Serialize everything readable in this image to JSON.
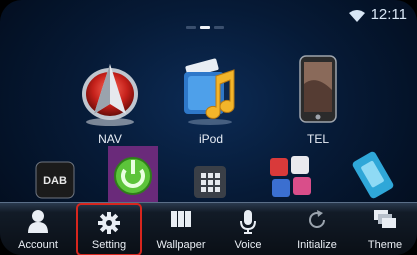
{
  "status": {
    "time": "12:11",
    "wifi_icon": "wifi-icon"
  },
  "apps": [
    {
      "label": "NAV",
      "icon": "nav-icon"
    },
    {
      "label": "iPod",
      "icon": "ipod-icon"
    },
    {
      "label": "TEL",
      "icon": "phone-icon"
    }
  ],
  "dock_apps": [
    {
      "icon": "dab-icon",
      "badge": "DAB"
    },
    {
      "icon": "power-icon"
    },
    {
      "icon": "grid-icon"
    },
    {
      "icon": "apps-icon"
    },
    {
      "icon": "usb-icon"
    }
  ],
  "bottom_tabs": [
    {
      "label": "Account",
      "icon": "person-icon"
    },
    {
      "label": "Setting",
      "icon": "gear-icon",
      "highlighted": true
    },
    {
      "label": "Wallpaper",
      "icon": "wallpaper-icon"
    },
    {
      "label": "Voice",
      "icon": "microphone-icon"
    },
    {
      "label": "Initialize",
      "icon": "refresh-icon"
    },
    {
      "label": "Theme",
      "icon": "theme-icon"
    }
  ],
  "colors": {
    "highlight": "#d7261e",
    "background": "#061a36"
  }
}
